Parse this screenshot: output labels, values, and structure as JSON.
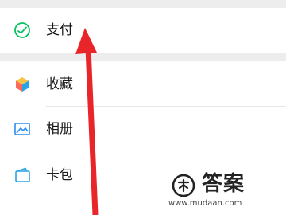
{
  "menu": {
    "items": [
      {
        "label": "支付",
        "icon": "pay-icon"
      },
      {
        "label": "收藏",
        "icon": "favorites-icon"
      },
      {
        "label": "相册",
        "icon": "album-icon"
      },
      {
        "label": "卡包",
        "icon": "card-wallet-icon"
      }
    ]
  },
  "colors": {
    "pay_green": "#07c160",
    "arrow_red": "#e8262a",
    "page_bg": "#ededed"
  },
  "watermark": {
    "name": "答案",
    "url": "www.mudaan.com"
  }
}
